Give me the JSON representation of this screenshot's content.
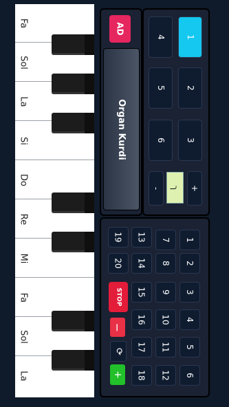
{
  "ad_label": "AD",
  "title": "Organ Kurdi",
  "keys": {
    "white": [
      "Fa",
      "Sol",
      "La",
      "Si",
      "Do",
      "Re",
      "Mi",
      "Fa",
      "Sol",
      "La"
    ]
  },
  "presets": [
    "1",
    "2",
    "3",
    "4",
    "5",
    "6"
  ],
  "transpose": {
    "minus": "-",
    "value": "ך",
    "plus": "+"
  },
  "rhythms": [
    "1",
    "2",
    "3",
    "4",
    "5",
    "6",
    "7",
    "8",
    "9",
    "10",
    "11",
    "12",
    "13",
    "14",
    "15",
    "16",
    "17",
    "18",
    "19",
    "20"
  ],
  "controls": {
    "stop": "STOP",
    "minus": "−",
    "loop": "⟳",
    "plus": "+"
  }
}
